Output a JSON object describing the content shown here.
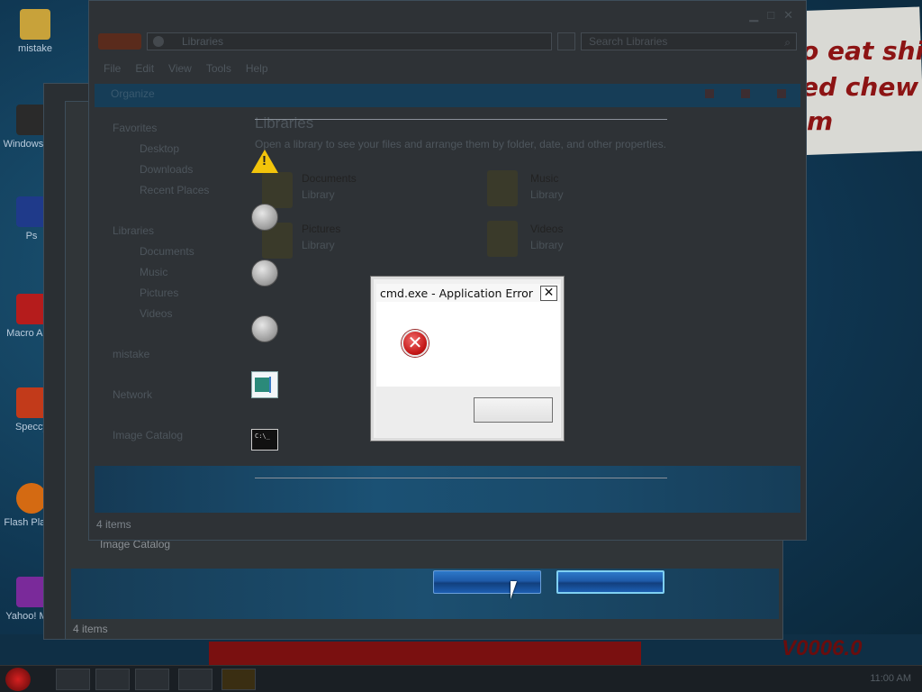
{
  "desktop": {
    "banner_lines": [
      "o eat shi",
      "ed chew",
      "m"
    ],
    "corner_code": "V0006.0",
    "icons": [
      {
        "label": "mistake",
        "color": "#c8a23a"
      },
      {
        "label": "Windows Vis",
        "color": "#2a2a2a"
      },
      {
        "label": "Ps",
        "color": "#1f3a8a"
      },
      {
        "label": "Macro Acro",
        "color": "#b51c1c"
      },
      {
        "label": "Speccy",
        "color": "#c23a1a"
      },
      {
        "label": "Flash Player",
        "color": "#d46a12"
      },
      {
        "label": "Yahoo! Mail",
        "color": "#7a2a9a"
      }
    ]
  },
  "explorer": {
    "address": "Libraries",
    "search_placeholder": "Search Libraries",
    "menu": [
      "File",
      "Edit",
      "View",
      "Tools",
      "Help"
    ],
    "organize": "Organize",
    "nav": {
      "favorites": "Favorites",
      "favorites_items": [
        "Desktop",
        "Downloads",
        "Recent Places"
      ],
      "libraries": "Libraries",
      "libraries_items": [
        "Documents",
        "Music",
        "Pictures",
        "Videos"
      ],
      "homegroup": "mistake",
      "network": "Network",
      "catalog": "Image Catalog"
    },
    "content_title": "Libraries",
    "content_subtitle": "Open a library to see your files and arrange them by folder, date, and other properties.",
    "libraries": [
      {
        "name": "Documents",
        "kind": "Library"
      },
      {
        "name": "Music",
        "kind": "Library"
      },
      {
        "name": "Pictures",
        "kind": "Library"
      },
      {
        "name": "Videos",
        "kind": "Library"
      }
    ],
    "status": "4 items"
  },
  "back_window": {
    "catalog": "Image Catalog",
    "status": "4 items"
  },
  "dialog": {
    "title": "cmd.exe - Application Error",
    "close": "✕",
    "error_glyph": "✕",
    "ok_label": ""
  },
  "buttons": {
    "primary_label": "",
    "secondary_label": ""
  },
  "taskbar": {
    "clock": "11:00 AM"
  },
  "colors": {
    "dialog_bg": "#f0f0f0",
    "error_red": "#c41717",
    "warning_yellow": "#f2c40b",
    "button_blue": "#1e5aa8"
  }
}
